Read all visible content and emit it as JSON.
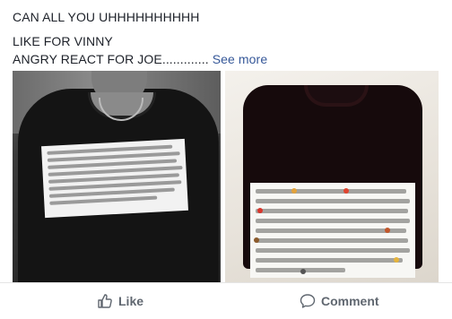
{
  "post": {
    "line1": "CAN ALL YOU UHHHHHHHHHH",
    "line2": "LIKE FOR VINNY",
    "line3": "ANGRY REACT FOR JOE.............",
    "see_more": "See more"
  },
  "photos": [
    {
      "icon": "shirt-photo-icon"
    },
    {
      "icon": "shirt-photo-icon"
    }
  ],
  "actions": {
    "like_label": "Like",
    "like_icon": "thumbs-up-icon",
    "comment_label": "Comment",
    "comment_icon": "speech-bubble-icon"
  },
  "colors": {
    "link": "#365899",
    "action_text": "#606770",
    "text": "#1d2129"
  }
}
